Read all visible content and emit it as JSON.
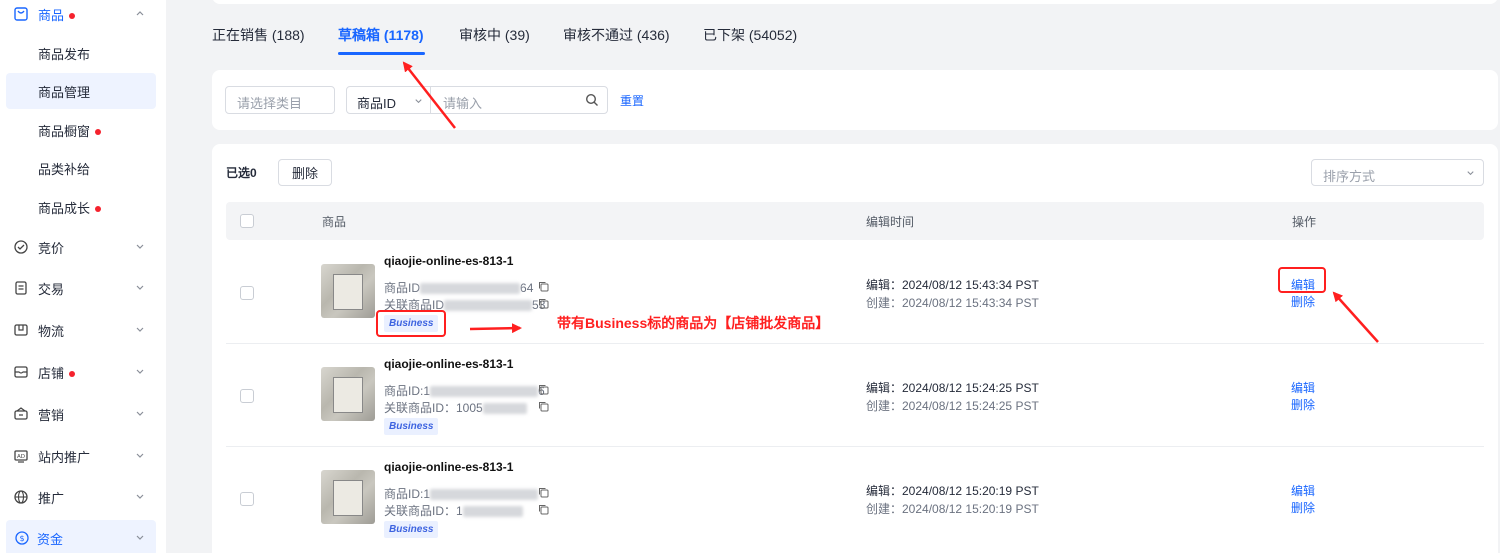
{
  "sidebar": {
    "items": [
      {
        "label": "商品",
        "dot": true,
        "icon": "shopping-bag-icon",
        "expanded": true
      },
      {
        "label": "竞价",
        "dot": false,
        "icon": "bid-icon"
      },
      {
        "label": "交易",
        "dot": false,
        "icon": "order-icon"
      },
      {
        "label": "物流",
        "dot": false,
        "icon": "logistics-icon"
      },
      {
        "label": "店铺",
        "dot": true,
        "icon": "store-icon"
      },
      {
        "label": "营销",
        "dot": false,
        "icon": "marketing-icon"
      },
      {
        "label": "站内推广",
        "dot": false,
        "icon": "ad-icon"
      },
      {
        "label": "推广",
        "dot": false,
        "icon": "globe-icon"
      },
      {
        "label": "资金",
        "dot": false,
        "icon": "funds-icon",
        "highlighted": true
      }
    ],
    "sub_items": [
      {
        "label": "商品发布",
        "dot": false
      },
      {
        "label": "商品管理",
        "dot": false,
        "active": true
      },
      {
        "label": "商品橱窗",
        "dot": true
      },
      {
        "label": "品类补给",
        "dot": false
      },
      {
        "label": "商品成长",
        "dot": true
      }
    ]
  },
  "tabs": [
    {
      "label": "正在销售 (188)"
    },
    {
      "label": "草稿箱 (1178)",
      "active": true
    },
    {
      "label": "审核中 (39)"
    },
    {
      "label": "审核不通过 (436)"
    },
    {
      "label": "已下架 (54052)"
    }
  ],
  "filters": {
    "category_placeholder": "请选择类目",
    "id_type": "商品ID",
    "search_placeholder": "请输入",
    "reset": "重置"
  },
  "toolbar": {
    "selected": "已选0",
    "delete": "删除",
    "sort_placeholder": "排序方式"
  },
  "table": {
    "headers": {
      "product": "商品",
      "edit_time": "编辑时间",
      "actions": "操作"
    },
    "rows": [
      {
        "name": "qiaojie-online-es-813-1",
        "id_label": "商品ID",
        "id_value_suffix": "64",
        "related_label": "关联商品ID",
        "related_value_suffix": "53",
        "badge": "Business",
        "edited": "编辑：2024/08/12 15:43:34 PST",
        "created": "创建：2024/08/12 15:43:34 PST",
        "edit": "编辑",
        "delete": "删除"
      },
      {
        "name": "qiaojie-online-es-813-1",
        "id_label": "商品ID:1",
        "id_value_suffix": "6",
        "related_label": "关联商品ID：1005",
        "related_value_suffix": "",
        "badge": "Business",
        "edited": "编辑：2024/08/12 15:24:25 PST",
        "created": "创建：2024/08/12 15:24:25 PST",
        "edit": "编辑",
        "delete": "删除"
      },
      {
        "name": "qiaojie-online-es-813-1",
        "id_label": "商品ID:1",
        "id_value_suffix": "",
        "related_label": "关联商品ID：1",
        "related_value_suffix": "",
        "badge": "Business",
        "edited": "编辑：2024/08/12 15:20:19 PST",
        "created": "创建：2024/08/12 15:20:19 PST",
        "edit": "编辑",
        "delete": "删除"
      }
    ]
  },
  "annotation": {
    "text": "带有Business标的商品为【店铺批发商品】",
    "color": "#ff1f1f"
  },
  "colors": {
    "accent": "#1966ff",
    "alert_dot": "#f5222d"
  }
}
